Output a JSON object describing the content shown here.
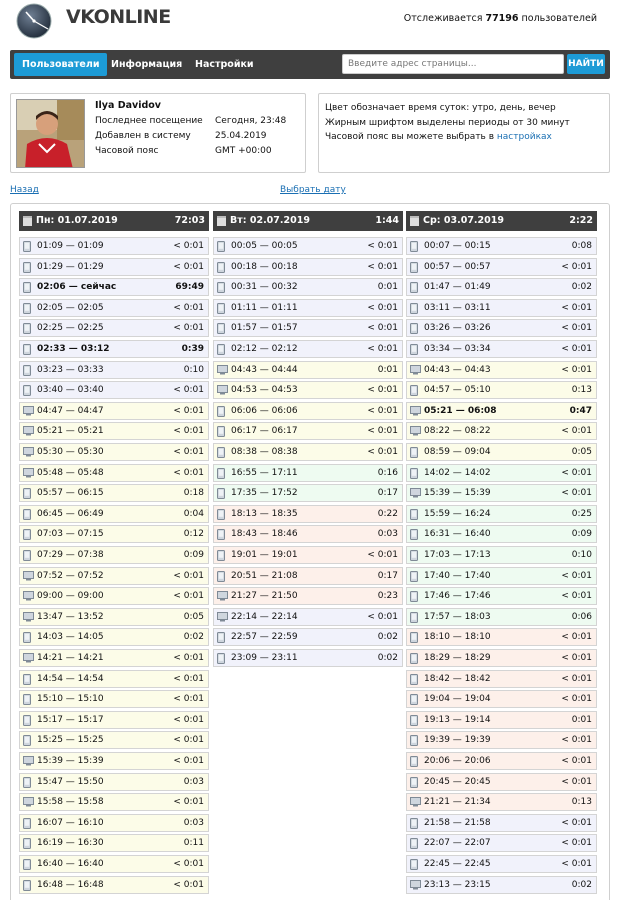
{
  "header": {
    "brand_prefix": "VK",
    "brand_suffix": "ONLINE",
    "tracked_prefix": "Отслеживается",
    "tracked_count": "77196",
    "tracked_suffix": "пользователей"
  },
  "nav": {
    "tabs": [
      "Пользователи",
      "Информация",
      "Настройки"
    ],
    "search_placeholder": "Введите адрес страницы...",
    "find_label": "НАЙТИ"
  },
  "user": {
    "name": "Ilya Davidov",
    "fields": [
      {
        "label": "Последнее посещение",
        "value": "Сегодня, 23:48"
      },
      {
        "label": "Добавлен в систему",
        "value": "25.04.2019"
      },
      {
        "label": "Часовой пояс",
        "value": "GMT +00:00"
      }
    ]
  },
  "info": {
    "line1": "Цвет обозначает время суток: утро, день, вечер",
    "line2": "Жирным шрифтом выделены периоды от 30 минут",
    "line3_prefix": "Часовой пояс вы можете выбрать в",
    "line3_link": "настройках"
  },
  "links": {
    "back": "Назад",
    "choose_date": "Выбрать дату"
  },
  "colors": {
    "accent": "#1d9bd6",
    "header": "#3f3f3f",
    "night": "#f1f2fb",
    "morning": "#eefbf1",
    "day": "#fcfce8",
    "evening": "#fdf0ea"
  },
  "days": [
    {
      "date": "Пн: 01.07.2019",
      "total": "72:03",
      "sessions": [
        {
          "r": "01:09 — 01:09",
          "d": "< 0:01",
          "dev": "phone",
          "p": "night"
        },
        {
          "r": "01:29 — 01:29",
          "d": "< 0:01",
          "dev": "phone",
          "p": "night"
        },
        {
          "r": "02:06 — сейчас",
          "d": "69:49",
          "dev": "phone",
          "p": "night",
          "b": true
        },
        {
          "r": "02:05 — 02:05",
          "d": "< 0:01",
          "dev": "phone",
          "p": "night"
        },
        {
          "r": "02:25 — 02:25",
          "d": "< 0:01",
          "dev": "phone",
          "p": "night"
        },
        {
          "r": "02:33 — 03:12",
          "d": "0:39",
          "dev": "phone",
          "p": "night",
          "b": true
        },
        {
          "r": "03:23 — 03:33",
          "d": "0:10",
          "dev": "phone",
          "p": "night"
        },
        {
          "r": "03:40 — 03:40",
          "d": "< 0:01",
          "dev": "phone",
          "p": "night"
        },
        {
          "r": "04:47 — 04:47",
          "d": "< 0:01",
          "dev": "pc",
          "p": "day"
        },
        {
          "r": "05:21 — 05:21",
          "d": "< 0:01",
          "dev": "pc",
          "p": "day"
        },
        {
          "r": "05:30 — 05:30",
          "d": "< 0:01",
          "dev": "pc",
          "p": "day"
        },
        {
          "r": "05:48 — 05:48",
          "d": "< 0:01",
          "dev": "pc",
          "p": "day"
        },
        {
          "r": "05:57 — 06:15",
          "d": "0:18",
          "dev": "phone",
          "p": "day"
        },
        {
          "r": "06:45 — 06:49",
          "d": "0:04",
          "dev": "phone",
          "p": "day"
        },
        {
          "r": "07:03 — 07:15",
          "d": "0:12",
          "dev": "phone",
          "p": "day"
        },
        {
          "r": "07:29 — 07:38",
          "d": "0:09",
          "dev": "phone",
          "p": "day"
        },
        {
          "r": "07:52 — 07:52",
          "d": "< 0:01",
          "dev": "pc",
          "p": "day"
        },
        {
          "r": "09:00 — 09:00",
          "d": "< 0:01",
          "dev": "pc",
          "p": "day"
        },
        {
          "r": "13:47 — 13:52",
          "d": "0:05",
          "dev": "pc",
          "p": "day"
        },
        {
          "r": "14:03 — 14:05",
          "d": "0:02",
          "dev": "phone",
          "p": "day"
        },
        {
          "r": "14:21 — 14:21",
          "d": "< 0:01",
          "dev": "pc",
          "p": "day"
        },
        {
          "r": "14:54 — 14:54",
          "d": "< 0:01",
          "dev": "phone",
          "p": "day"
        },
        {
          "r": "15:10 — 15:10",
          "d": "< 0:01",
          "dev": "phone",
          "p": "day"
        },
        {
          "r": "15:17 — 15:17",
          "d": "< 0:01",
          "dev": "phone",
          "p": "day"
        },
        {
          "r": "15:25 — 15:25",
          "d": "< 0:01",
          "dev": "phone",
          "p": "day"
        },
        {
          "r": "15:39 — 15:39",
          "d": "< 0:01",
          "dev": "pc",
          "p": "day"
        },
        {
          "r": "15:47 — 15:50",
          "d": "0:03",
          "dev": "phone",
          "p": "day"
        },
        {
          "r": "15:58 — 15:58",
          "d": "< 0:01",
          "dev": "pc",
          "p": "day"
        },
        {
          "r": "16:07 — 16:10",
          "d": "0:03",
          "dev": "phone",
          "p": "day"
        },
        {
          "r": "16:19 — 16:30",
          "d": "0:11",
          "dev": "phone",
          "p": "day"
        },
        {
          "r": "16:40 — 16:40",
          "d": "< 0:01",
          "dev": "phone",
          "p": "day"
        },
        {
          "r": "16:48 — 16:48",
          "d": "< 0:01",
          "dev": "phone",
          "p": "day"
        }
      ]
    },
    {
      "date": "Вт: 02.07.2019",
      "total": "1:44",
      "sessions": [
        {
          "r": "00:05 — 00:05",
          "d": "< 0:01",
          "dev": "phone",
          "p": "night"
        },
        {
          "r": "00:18 — 00:18",
          "d": "< 0:01",
          "dev": "phone",
          "p": "night"
        },
        {
          "r": "00:31 — 00:32",
          "d": "0:01",
          "dev": "phone",
          "p": "night"
        },
        {
          "r": "01:11 — 01:11",
          "d": "< 0:01",
          "dev": "phone",
          "p": "night"
        },
        {
          "r": "01:57 — 01:57",
          "d": "< 0:01",
          "dev": "phone",
          "p": "night"
        },
        {
          "r": "02:12 — 02:12",
          "d": "< 0:01",
          "dev": "phone",
          "p": "night"
        },
        {
          "r": "04:43 — 04:44",
          "d": "0:01",
          "dev": "pc",
          "p": "day"
        },
        {
          "r": "04:53 — 04:53",
          "d": "< 0:01",
          "dev": "pc",
          "p": "day"
        },
        {
          "r": "06:06 — 06:06",
          "d": "< 0:01",
          "dev": "phone",
          "p": "day"
        },
        {
          "r": "06:17 — 06:17",
          "d": "< 0:01",
          "dev": "phone",
          "p": "day"
        },
        {
          "r": "08:38 — 08:38",
          "d": "< 0:01",
          "dev": "phone",
          "p": "day"
        },
        {
          "r": "16:55 — 17:11",
          "d": "0:16",
          "dev": "phone",
          "p": "morning"
        },
        {
          "r": "17:35 — 17:52",
          "d": "0:17",
          "dev": "phone",
          "p": "morning"
        },
        {
          "r": "18:13 — 18:35",
          "d": "0:22",
          "dev": "phone",
          "p": "evening"
        },
        {
          "r": "18:43 — 18:46",
          "d": "0:03",
          "dev": "phone",
          "p": "evening"
        },
        {
          "r": "19:01 — 19:01",
          "d": "< 0:01",
          "dev": "phone",
          "p": "evening"
        },
        {
          "r": "20:51 — 21:08",
          "d": "0:17",
          "dev": "phone",
          "p": "evening"
        },
        {
          "r": "21:27 — 21:50",
          "d": "0:23",
          "dev": "pc",
          "p": "evening"
        },
        {
          "r": "22:14 — 22:14",
          "d": "< 0:01",
          "dev": "pc",
          "p": "night"
        },
        {
          "r": "22:57 — 22:59",
          "d": "0:02",
          "dev": "phone",
          "p": "night"
        },
        {
          "r": "23:09 — 23:11",
          "d": "0:02",
          "dev": "phone",
          "p": "night"
        }
      ]
    },
    {
      "date": "Ср: 03.07.2019",
      "total": "2:22",
      "sessions": [
        {
          "r": "00:07 — 00:15",
          "d": "0:08",
          "dev": "phone",
          "p": "night"
        },
        {
          "r": "00:57 — 00:57",
          "d": "< 0:01",
          "dev": "phone",
          "p": "night"
        },
        {
          "r": "01:47 — 01:49",
          "d": "0:02",
          "dev": "phone",
          "p": "night"
        },
        {
          "r": "03:11 — 03:11",
          "d": "< 0:01",
          "dev": "phone",
          "p": "night"
        },
        {
          "r": "03:26 — 03:26",
          "d": "< 0:01",
          "dev": "phone",
          "p": "night"
        },
        {
          "r": "03:34 — 03:34",
          "d": "< 0:01",
          "dev": "phone",
          "p": "night"
        },
        {
          "r": "04:43 — 04:43",
          "d": "< 0:01",
          "dev": "pc",
          "p": "day"
        },
        {
          "r": "04:57 — 05:10",
          "d": "0:13",
          "dev": "phone",
          "p": "day"
        },
        {
          "r": "05:21 — 06:08",
          "d": "0:47",
          "dev": "pc",
          "p": "day",
          "b": true
        },
        {
          "r": "08:22 — 08:22",
          "d": "< 0:01",
          "dev": "pc",
          "p": "day"
        },
        {
          "r": "08:59 — 09:04",
          "d": "0:05",
          "dev": "phone",
          "p": "day"
        },
        {
          "r": "14:02 — 14:02",
          "d": "< 0:01",
          "dev": "phone",
          "p": "morning"
        },
        {
          "r": "15:39 — 15:39",
          "d": "< 0:01",
          "dev": "pc",
          "p": "morning"
        },
        {
          "r": "15:59 — 16:24",
          "d": "0:25",
          "dev": "phone",
          "p": "morning"
        },
        {
          "r": "16:31 — 16:40",
          "d": "0:09",
          "dev": "phone",
          "p": "morning"
        },
        {
          "r": "17:03 — 17:13",
          "d": "0:10",
          "dev": "phone",
          "p": "morning"
        },
        {
          "r": "17:40 — 17:40",
          "d": "< 0:01",
          "dev": "phone",
          "p": "morning"
        },
        {
          "r": "17:46 — 17:46",
          "d": "< 0:01",
          "dev": "phone",
          "p": "morning"
        },
        {
          "r": "17:57 — 18:03",
          "d": "0:06",
          "dev": "phone",
          "p": "morning"
        },
        {
          "r": "18:10 — 18:10",
          "d": "< 0:01",
          "dev": "phone",
          "p": "evening"
        },
        {
          "r": "18:29 — 18:29",
          "d": "< 0:01",
          "dev": "phone",
          "p": "evening"
        },
        {
          "r": "18:42 — 18:42",
          "d": "< 0:01",
          "dev": "phone",
          "p": "evening"
        },
        {
          "r": "19:04 — 19:04",
          "d": "< 0:01",
          "dev": "phone",
          "p": "evening"
        },
        {
          "r": "19:13 — 19:14",
          "d": "0:01",
          "dev": "phone",
          "p": "evening"
        },
        {
          "r": "19:39 — 19:39",
          "d": "< 0:01",
          "dev": "phone",
          "p": "evening"
        },
        {
          "r": "20:06 — 20:06",
          "d": "< 0:01",
          "dev": "phone",
          "p": "evening"
        },
        {
          "r": "20:45 — 20:45",
          "d": "< 0:01",
          "dev": "phone",
          "p": "evening"
        },
        {
          "r": "21:21 — 21:34",
          "d": "0:13",
          "dev": "pc",
          "p": "evening"
        },
        {
          "r": "21:58 — 21:58",
          "d": "< 0:01",
          "dev": "phone",
          "p": "night"
        },
        {
          "r": "22:07 — 22:07",
          "d": "< 0:01",
          "dev": "phone",
          "p": "night"
        },
        {
          "r": "22:45 — 22:45",
          "d": "< 0:01",
          "dev": "phone",
          "p": "night"
        },
        {
          "r": "23:13 — 23:15",
          "d": "0:02",
          "dev": "pc",
          "p": "night"
        }
      ]
    }
  ]
}
